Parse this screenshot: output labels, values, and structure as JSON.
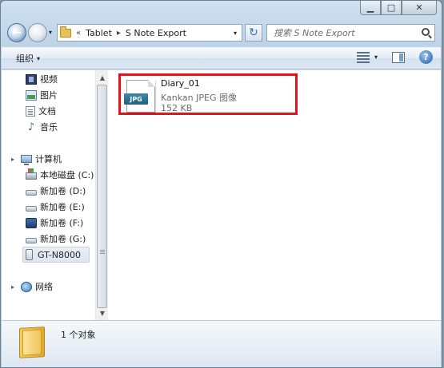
{
  "window": {
    "caption": {
      "minimize": "▁",
      "maximize": "□",
      "close": "✕"
    }
  },
  "navigation": {
    "back_icon": "←",
    "forward_icon": "→",
    "history_arrow": "▾",
    "breadcrumb_overflow": "«",
    "breadcrumbs": [
      "Tablet",
      "S Note Export"
    ],
    "separator": "▸",
    "address_dropdown": "▾",
    "refresh_icon": "↻",
    "search_placeholder": "搜索 S Note Export"
  },
  "toolbar": {
    "organize_label": "组织",
    "organize_arrow": "▾",
    "view_arrow": "▾",
    "help_label": "?"
  },
  "sidebar": {
    "libraries": [
      {
        "label": "视频",
        "icon": "video-icon"
      },
      {
        "label": "图片",
        "icon": "picture-icon"
      },
      {
        "label": "文档",
        "icon": "document-icon"
      },
      {
        "label": "音乐",
        "icon": "music-icon"
      }
    ],
    "computer": {
      "label": "计算机",
      "expander": "▸",
      "drives": [
        {
          "label": "本地磁盘 (C:)"
        },
        {
          "label": "新加卷 (D:)"
        },
        {
          "label": "新加卷 (E:)"
        },
        {
          "label": "新加卷 (F:)"
        },
        {
          "label": "新加卷 (G:)"
        },
        {
          "label": "GT-N8000"
        }
      ]
    },
    "network": {
      "label": "网络",
      "expander": "▸"
    },
    "music_glyph": "♪",
    "scroll_up": "▲",
    "scroll_down": "▼"
  },
  "files": [
    {
      "name": "Diary_01",
      "type": "Kankan JPEG 图像",
      "size": "152 KB",
      "badge": "JPG"
    }
  ],
  "status": {
    "item_count": "1 个对象"
  },
  "colors": {
    "highlight_border": "#e0141e",
    "window_frame": "#bcd2e6",
    "selected_nav": "#dde5ee"
  }
}
